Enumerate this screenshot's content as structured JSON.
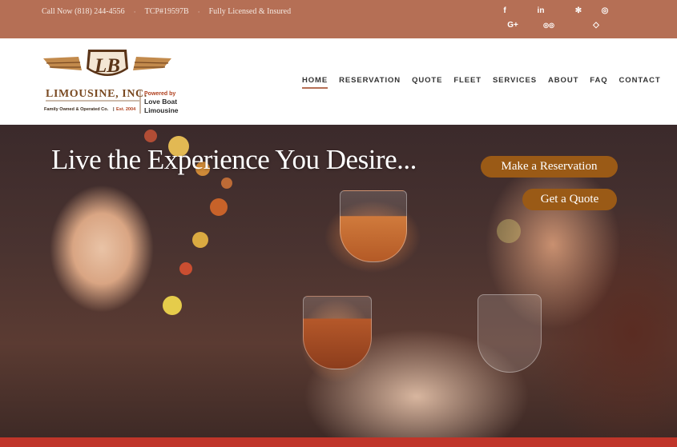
{
  "topbar": {
    "phone": "Call Now (818) 244-4556",
    "tcp": "TCP#19597B",
    "licensed": "Fully Licensed & Insured",
    "separator": "·",
    "social": [
      {
        "name": "facebook",
        "glyph": "f"
      },
      {
        "name": "linkedin",
        "glyph": "in"
      },
      {
        "name": "yelp",
        "glyph": "✻"
      },
      {
        "name": "instagram",
        "glyph": "◎"
      },
      {
        "name": "google-plus",
        "glyph": "G+"
      },
      {
        "name": "tripadvisor",
        "glyph": "◎◎"
      },
      {
        "name": "diamond",
        "glyph": "◇"
      }
    ]
  },
  "logo": {
    "monogram": "LB",
    "name": "LIMOUSINE, INC.",
    "tagline_left": "Family Owned & Operated Co.",
    "tagline_right": "Est. 2004",
    "powered_by": "Powered by",
    "partner_line1": "Love Boat",
    "partner_line2": "Limousine"
  },
  "nav": [
    "HOME",
    "RESERVATION",
    "QUOTE",
    "FLEET",
    "SERVICES",
    "ABOUT",
    "FAQ",
    "CONTACT"
  ],
  "hero": {
    "title": "Live the Experience You Desire...",
    "cta_reservation": "Make a Reservation",
    "cta_quote": "Get a Quote"
  },
  "colors": {
    "topbar": "#b56f55",
    "cta": "#9a5a16",
    "bottombar": "#c0352a",
    "logo_brown": "#5a3418",
    "logo_gold": "#c28a4c"
  }
}
